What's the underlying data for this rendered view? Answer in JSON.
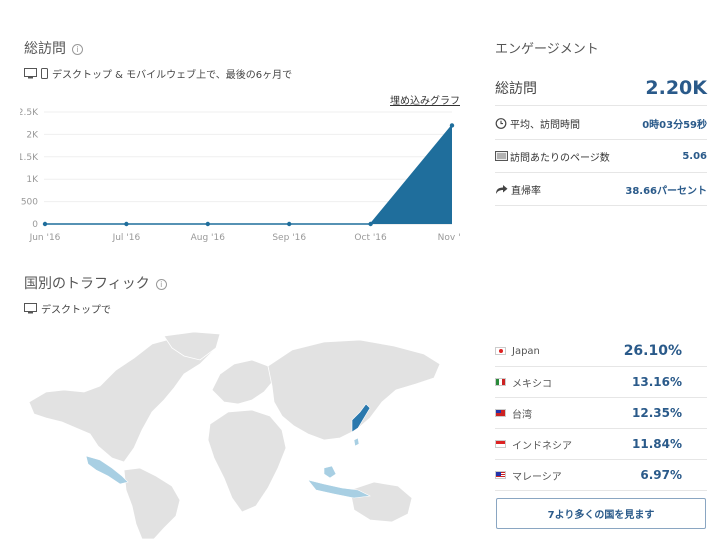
{
  "visits": {
    "title": "総訪問",
    "info": "i",
    "subtitle": "デスクトップ & モバイルウェブ上で、最後の6ヶ月で",
    "embed_link": "埋め込みグラフ"
  },
  "chart_data": {
    "type": "area",
    "categories": [
      "Jun '16",
      "Jul '16",
      "Aug '16",
      "Sep '16",
      "Oct '16",
      "Nov '1"
    ],
    "values": [
      0,
      0,
      0,
      0,
      0,
      2200
    ],
    "y_ticks": [
      "0",
      "500",
      "1K",
      "1.5K",
      "2K",
      "2.5K"
    ],
    "y_tick_values": [
      0,
      500,
      1000,
      1500,
      2000,
      2500
    ],
    "ylim": [
      0,
      2500
    ],
    "color": "#1f6e9c",
    "grid": true
  },
  "engagement": {
    "title": "エンゲージメント",
    "total_label": "総訪問",
    "total_value": "2.20K",
    "rows": [
      {
        "icon": "clock-icon",
        "label": "平均、訪問時間",
        "value": "0時03分59秒"
      },
      {
        "icon": "pages-icon",
        "label": "訪問あたりのページ数",
        "value": "5.06"
      },
      {
        "icon": "bounce-arrow-icon",
        "label": "直帰率",
        "value": "38.66パーセント"
      }
    ]
  },
  "traffic": {
    "title": "国別のトラフィック",
    "info": "i",
    "subtitle": "デスクトップで"
  },
  "countries": [
    {
      "name": "Japan",
      "pct": "26.10%",
      "flag": "flag-japan-icon"
    },
    {
      "name": "メキシコ",
      "pct": "13.16%",
      "flag": "flag-mexico-icon"
    },
    {
      "name": "台湾",
      "pct": "12.35%",
      "flag": "flag-taiwan-icon"
    },
    {
      "name": "インドネシア",
      "pct": "11.84%",
      "flag": "flag-indonesia-icon"
    },
    {
      "name": "マレーシア",
      "pct": "6.97%",
      "flag": "flag-malaysia-icon"
    }
  ],
  "more_button": "7より多くの国を見ます",
  "colors": {
    "accent": "#1f6e9c",
    "map_land": "#e2e2e2",
    "map_highlight": "#a8cfe3",
    "map_top": "#2a78ad"
  }
}
